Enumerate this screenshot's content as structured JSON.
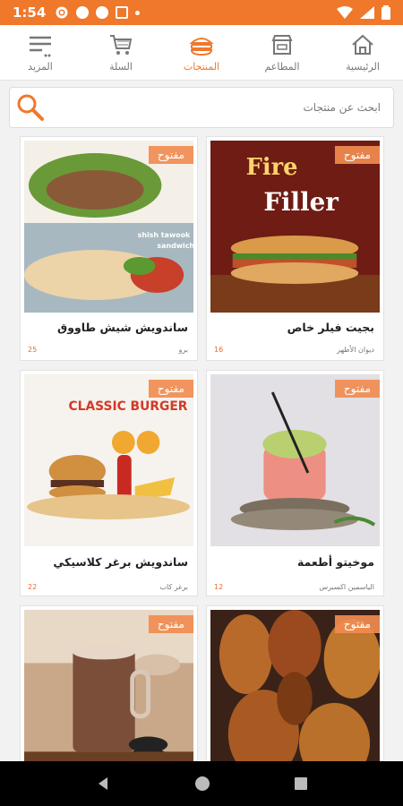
{
  "status_bar": {
    "time": "1:54"
  },
  "nav": {
    "items": [
      {
        "label": "الرئيسية",
        "icon": "home-icon"
      },
      {
        "label": "المطاعم",
        "icon": "restaurant-icon"
      },
      {
        "label": "المنتجات",
        "icon": "products-icon",
        "active": true
      },
      {
        "label": "السلة",
        "icon": "cart-icon"
      },
      {
        "label": "المزيد",
        "icon": "menu-icon"
      }
    ]
  },
  "search": {
    "placeholder": "ابحث عن منتجات"
  },
  "products": [
    {
      "title": "بجيت فيلر خاص",
      "store": "ديوان الأطهر",
      "price": "16",
      "badge": "مفتوح",
      "image_text": [
        "Fire",
        "Filler"
      ]
    },
    {
      "title": "ساندويش شيش طاووق",
      "store": "برو",
      "price": "25",
      "badge": "مفتوح",
      "image_text": [
        "shish tawook",
        "sandwich"
      ]
    },
    {
      "title": "موخيتو أطعمة",
      "store": "الياسمين اكسبرس",
      "price": "12",
      "badge": "مفتوح"
    },
    {
      "title": "ساندويش برغر كلاسيكي",
      "store": "برغر كاب",
      "price": "22",
      "badge": "مفتوح",
      "image_text": [
        "CLASSIC BURGER"
      ]
    },
    {
      "title": "",
      "store": "",
      "price": "",
      "badge": "مفتوح"
    },
    {
      "title": "",
      "store": "",
      "price": "",
      "badge": "مفتوح"
    }
  ],
  "colors": {
    "accent": "#f0782a"
  }
}
